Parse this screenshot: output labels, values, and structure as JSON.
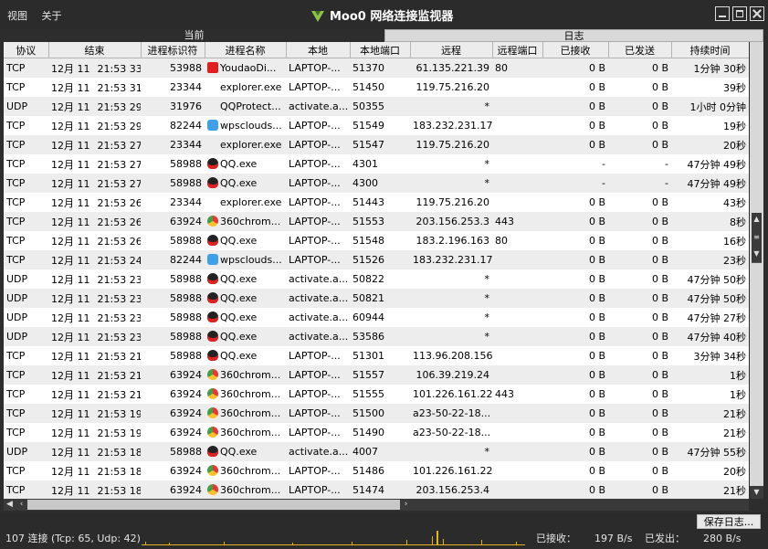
{
  "menu": {
    "view": "视图",
    "about": "关于"
  },
  "window": {
    "title": "Moo0 网络连接监视器"
  },
  "groups": {
    "current": "当前",
    "log": "日志"
  },
  "columns": [
    "协议",
    "结束",
    "进程标识符",
    "进程名称",
    "本地",
    "本地端口",
    "远程",
    "远程端口",
    "已接收",
    "已发送",
    "持续时间"
  ],
  "rows": [
    {
      "proto": "TCP",
      "date": "12月 11",
      "time": "21:53 33",
      "pid": "53988",
      "icon": "youdao",
      "name": "YoudaoDi...",
      "local": "LAPTOP-...",
      "lport": "51370",
      "remote": "61.135.221.39",
      "rport": "80",
      "recv": "0 B",
      "sent": "0 B",
      "dur": "1分钟 30秒"
    },
    {
      "proto": "TCP",
      "date": "12月 11",
      "time": "21:53 31",
      "pid": "23344",
      "icon": "none",
      "name": "explorer.exe",
      "local": "LAPTOP-...",
      "lport": "51450",
      "remote": "119.75.216.20",
      "rport": "",
      "recv": "0 B",
      "sent": "0 B",
      "dur": "39秒"
    },
    {
      "proto": "UDP",
      "date": "12月 11",
      "time": "21:53 29",
      "pid": "31976",
      "icon": "none",
      "name": "QQProtect...",
      "local": "activate.a...",
      "lport": "50355",
      "remote": "*",
      "rport": "",
      "recv": "0 B",
      "sent": "0 B",
      "dur": "1小时 0分钟"
    },
    {
      "proto": "TCP",
      "date": "12月 11",
      "time": "21:53 29",
      "pid": "82244",
      "icon": "wps",
      "name": "wpsclouds...",
      "local": "LAPTOP-...",
      "lport": "51549",
      "remote": "183.232.231.172",
      "rport": "",
      "recv": "0 B",
      "sent": "0 B",
      "dur": "19秒"
    },
    {
      "proto": "TCP",
      "date": "12月 11",
      "time": "21:53 27",
      "pid": "23344",
      "icon": "none",
      "name": "explorer.exe",
      "local": "LAPTOP-...",
      "lport": "51547",
      "remote": "119.75.216.20",
      "rport": "",
      "recv": "0 B",
      "sent": "0 B",
      "dur": "20秒"
    },
    {
      "proto": "TCP",
      "date": "12月 11",
      "time": "21:53 27",
      "pid": "58988",
      "icon": "qq",
      "name": "QQ.exe",
      "local": "LAPTOP-...",
      "lport": "4301",
      "remote": "*",
      "rport": "",
      "recv": "-",
      "sent": "-",
      "dur": "47分钟 49秒"
    },
    {
      "proto": "TCP",
      "date": "12月 11",
      "time": "21:53 27",
      "pid": "58988",
      "icon": "qq",
      "name": "QQ.exe",
      "local": "LAPTOP-...",
      "lport": "4300",
      "remote": "*",
      "rport": "",
      "recv": "-",
      "sent": "-",
      "dur": "47分钟 49秒"
    },
    {
      "proto": "TCP",
      "date": "12月 11",
      "time": "21:53 26",
      "pid": "23344",
      "icon": "none",
      "name": "explorer.exe",
      "local": "LAPTOP-...",
      "lport": "51443",
      "remote": "119.75.216.20",
      "rport": "",
      "recv": "0 B",
      "sent": "0 B",
      "dur": "43秒"
    },
    {
      "proto": "TCP",
      "date": "12月 11",
      "time": "21:53 26",
      "pid": "63924",
      "icon": "chrome",
      "name": "360chrom...",
      "local": "LAPTOP-...",
      "lport": "51553",
      "remote": "203.156.253.3",
      "rport": "443",
      "recv": "0 B",
      "sent": "0 B",
      "dur": "8秒"
    },
    {
      "proto": "TCP",
      "date": "12月 11",
      "time": "21:53 26",
      "pid": "58988",
      "icon": "qq",
      "name": "QQ.exe",
      "local": "LAPTOP-...",
      "lport": "51548",
      "remote": "183.2.196.163",
      "rport": "80",
      "recv": "0 B",
      "sent": "0 B",
      "dur": "16秒"
    },
    {
      "proto": "TCP",
      "date": "12月 11",
      "time": "21:53 24",
      "pid": "82244",
      "icon": "wps",
      "name": "wpsclouds...",
      "local": "LAPTOP-...",
      "lport": "51526",
      "remote": "183.232.231.172",
      "rport": "",
      "recv": "0 B",
      "sent": "0 B",
      "dur": "23秒"
    },
    {
      "proto": "UDP",
      "date": "12月 11",
      "time": "21:53 23",
      "pid": "58988",
      "icon": "qq",
      "name": "QQ.exe",
      "local": "activate.a...",
      "lport": "50822",
      "remote": "*",
      "rport": "",
      "recv": "0 B",
      "sent": "0 B",
      "dur": "47分钟 50秒"
    },
    {
      "proto": "UDP",
      "date": "12月 11",
      "time": "21:53 23",
      "pid": "58988",
      "icon": "qq",
      "name": "QQ.exe",
      "local": "activate.a...",
      "lport": "50821",
      "remote": "*",
      "rport": "",
      "recv": "0 B",
      "sent": "0 B",
      "dur": "47分钟 50秒"
    },
    {
      "proto": "UDP",
      "date": "12月 11",
      "time": "21:53 23",
      "pid": "58988",
      "icon": "qq",
      "name": "QQ.exe",
      "local": "activate.a...",
      "lport": "60944",
      "remote": "*",
      "rport": "",
      "recv": "0 B",
      "sent": "0 B",
      "dur": "47分钟 27秒"
    },
    {
      "proto": "UDP",
      "date": "12月 11",
      "time": "21:53 23",
      "pid": "58988",
      "icon": "qq",
      "name": "QQ.exe",
      "local": "activate.a...",
      "lport": "53586",
      "remote": "*",
      "rport": "",
      "recv": "0 B",
      "sent": "0 B",
      "dur": "47分钟 40秒"
    },
    {
      "proto": "TCP",
      "date": "12月 11",
      "time": "21:53 21",
      "pid": "58988",
      "icon": "qq",
      "name": "QQ.exe",
      "local": "LAPTOP-...",
      "lport": "51301",
      "remote": "113.96.208.156",
      "rport": "",
      "recv": "0 B",
      "sent": "0 B",
      "dur": "3分钟 34秒"
    },
    {
      "proto": "TCP",
      "date": "12月 11",
      "time": "21:53 21",
      "pid": "63924",
      "icon": "chrome",
      "name": "360chrom...",
      "local": "LAPTOP-...",
      "lport": "51557",
      "remote": "106.39.219.24",
      "rport": "",
      "recv": "0 B",
      "sent": "0 B",
      "dur": "1秒"
    },
    {
      "proto": "TCP",
      "date": "12月 11",
      "time": "21:53 21",
      "pid": "63924",
      "icon": "chrome",
      "name": "360chrom...",
      "local": "LAPTOP-...",
      "lport": "51555",
      "remote": "101.226.161.228",
      "rport": "443",
      "recv": "0 B",
      "sent": "0 B",
      "dur": "1秒"
    },
    {
      "proto": "TCP",
      "date": "12月 11",
      "time": "21:53 19",
      "pid": "63924",
      "icon": "chrome",
      "name": "360chrom...",
      "local": "LAPTOP-...",
      "lport": "51500",
      "remote": "a23-50-22-18...",
      "rport": "",
      "recv": "0 B",
      "sent": "0 B",
      "dur": "21秒"
    },
    {
      "proto": "TCP",
      "date": "12月 11",
      "time": "21:53 19",
      "pid": "63924",
      "icon": "chrome",
      "name": "360chrom...",
      "local": "LAPTOP-...",
      "lport": "51490",
      "remote": "a23-50-22-18...",
      "rport": "",
      "recv": "0 B",
      "sent": "0 B",
      "dur": "21秒"
    },
    {
      "proto": "UDP",
      "date": "12月 11",
      "time": "21:53 18",
      "pid": "58988",
      "icon": "qq",
      "name": "QQ.exe",
      "local": "activate.a...",
      "lport": "4007",
      "remote": "*",
      "rport": "",
      "recv": "0 B",
      "sent": "0 B",
      "dur": "47分钟 55秒"
    },
    {
      "proto": "TCP",
      "date": "12月 11",
      "time": "21:53 18",
      "pid": "63924",
      "icon": "chrome",
      "name": "360chrom...",
      "local": "LAPTOP-...",
      "lport": "51486",
      "remote": "101.226.161.228",
      "rport": "",
      "recv": "0 B",
      "sent": "0 B",
      "dur": "20秒"
    },
    {
      "proto": "TCP",
      "date": "12月 11",
      "time": "21:53 18",
      "pid": "63924",
      "icon": "chrome",
      "name": "360chrom...",
      "local": "LAPTOP-...",
      "lport": "51474",
      "remote": "203.156.253.4",
      "rport": "",
      "recv": "0 B",
      "sent": "0 B",
      "dur": "21秒"
    }
  ],
  "status": {
    "connections": "107 连接 (Tcp: 65, Udp: 42)",
    "save_log": "保存日志...",
    "recv_label": "已接收：",
    "recv_value": "197 B/s",
    "sent_label": "已发出：",
    "sent_value": "280 B/s"
  },
  "colors": {
    "titlebar": "#2b2b2b",
    "graph": "#e3b21d"
  }
}
